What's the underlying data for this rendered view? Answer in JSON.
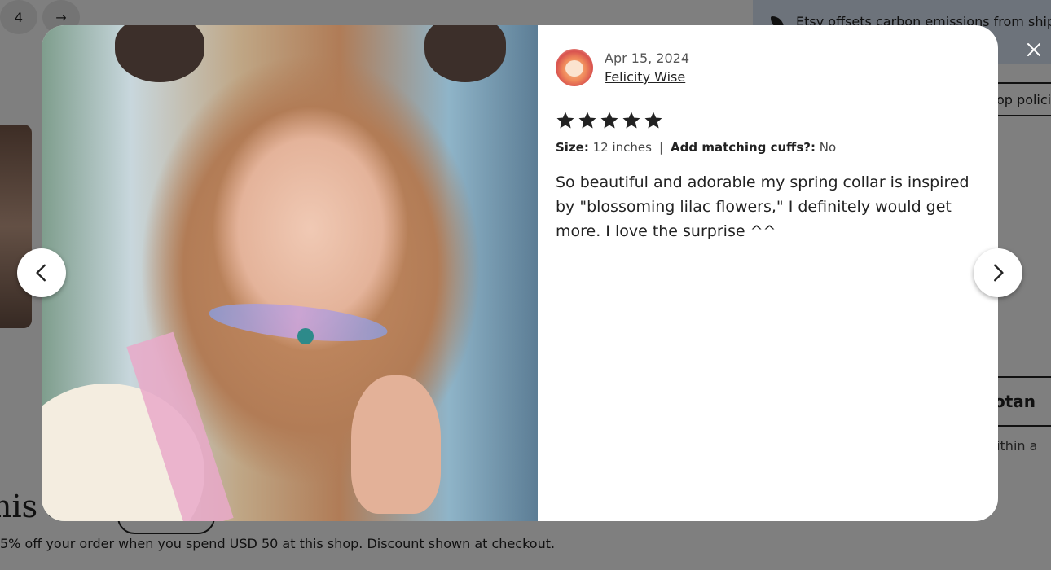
{
  "background": {
    "pagination": {
      "page_label": "4",
      "next_arrow": "→"
    },
    "carbon_banner": "Etsy offsets carbon emissions from ship",
    "policies_button": "op polici",
    "shop_name": "otan",
    "ships_within": "within a",
    "heading": "his s",
    "discount_text": "5% off your order when you spend USD 50 at this shop. Discount shown at checkout."
  },
  "review_modal": {
    "date": "Apr 15, 2024",
    "reviewer": "Felicity Wise",
    "rating": 5,
    "variations": [
      {
        "label": "Size:",
        "value": "12 inches"
      },
      {
        "label": "Add matching cuffs?:",
        "value": "No"
      }
    ],
    "separator": "|",
    "text": "So beautiful and adorable my spring collar is inspired by \"blossoming lilac flowers,\" I definitely would get more. I love the surprise ^^",
    "icons": {
      "prev": "chevron-left-icon",
      "next": "chevron-right-icon",
      "close": "close-icon",
      "star": "star-icon"
    },
    "colors": {
      "overlay": "#000000",
      "star": "#222222",
      "banner": "#dbe6f7"
    }
  }
}
